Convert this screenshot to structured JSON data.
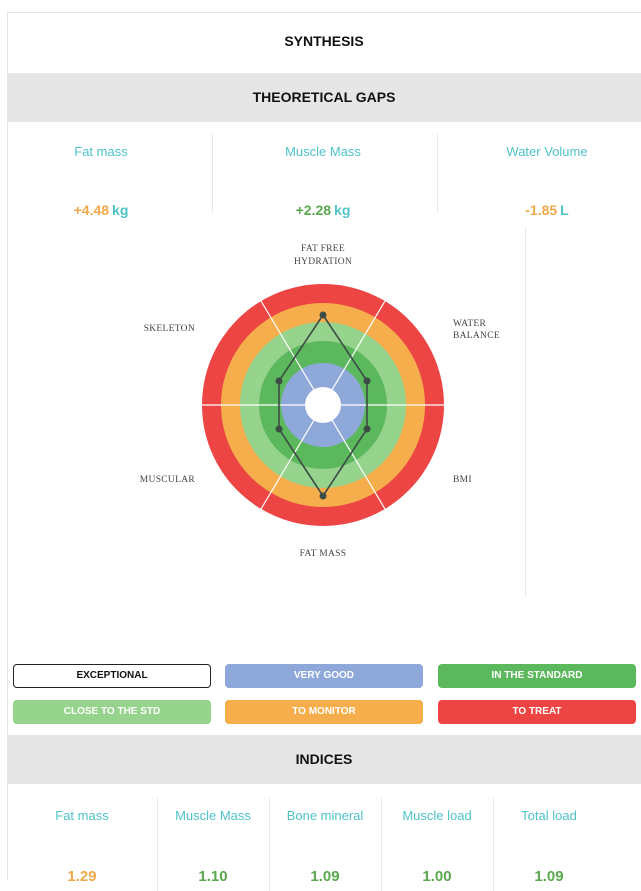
{
  "title": "SYNTHESIS",
  "theoretical_gaps": {
    "heading": "THEORETICAL GAPS",
    "items": [
      {
        "label": "Fat mass",
        "value": "+4.48",
        "unit": "kg",
        "color": "#f0a94a"
      },
      {
        "label": "Muscle Mass",
        "value": "+2.28",
        "unit": "kg",
        "color": "#5aa84e"
      },
      {
        "label": "Water Volume",
        "value": "-1.85",
        "unit": "L",
        "color": "#f0a94a"
      }
    ]
  },
  "radar": {
    "axes": {
      "top_line1": "FAT FREE",
      "top_line2": "HYDRATION",
      "upper_right_line1": "WATER",
      "upper_right_line2": "BALANCE",
      "lower_right": "BMI",
      "bottom": "FAT MASS",
      "lower_left": "MUSCULAR",
      "upper_left": "SKELETON"
    },
    "zone_colors": {
      "to_treat": "#ec4544",
      "to_monitor": "#f6ae4c",
      "close_to_std": "#96d38c",
      "in_standard": "#5cb85c",
      "very_good": "#8ea9d9"
    }
  },
  "legend": {
    "exceptional": "EXCEPTIONAL",
    "very_good": "VERY GOOD",
    "in_standard": "IN THE STANDARD",
    "close_to_std": "CLOSE TO THE STD",
    "to_monitor": "TO MONITOR",
    "to_treat": "TO TREAT"
  },
  "indices": {
    "heading": "INDICES",
    "items": [
      {
        "label": "Fat mass",
        "value": "1.29",
        "color": "#f0a94a"
      },
      {
        "label": "Muscle Mass",
        "value": "1.10",
        "color": "#5aa84e"
      },
      {
        "label": "Bone mineral",
        "value": "1.09",
        "color": "#5aa84e"
      },
      {
        "label": "Muscle load",
        "value": "1.00",
        "color": "#5aa84e"
      },
      {
        "label": "Total load",
        "value": "1.09",
        "color": "#5aa84e"
      }
    ]
  }
}
